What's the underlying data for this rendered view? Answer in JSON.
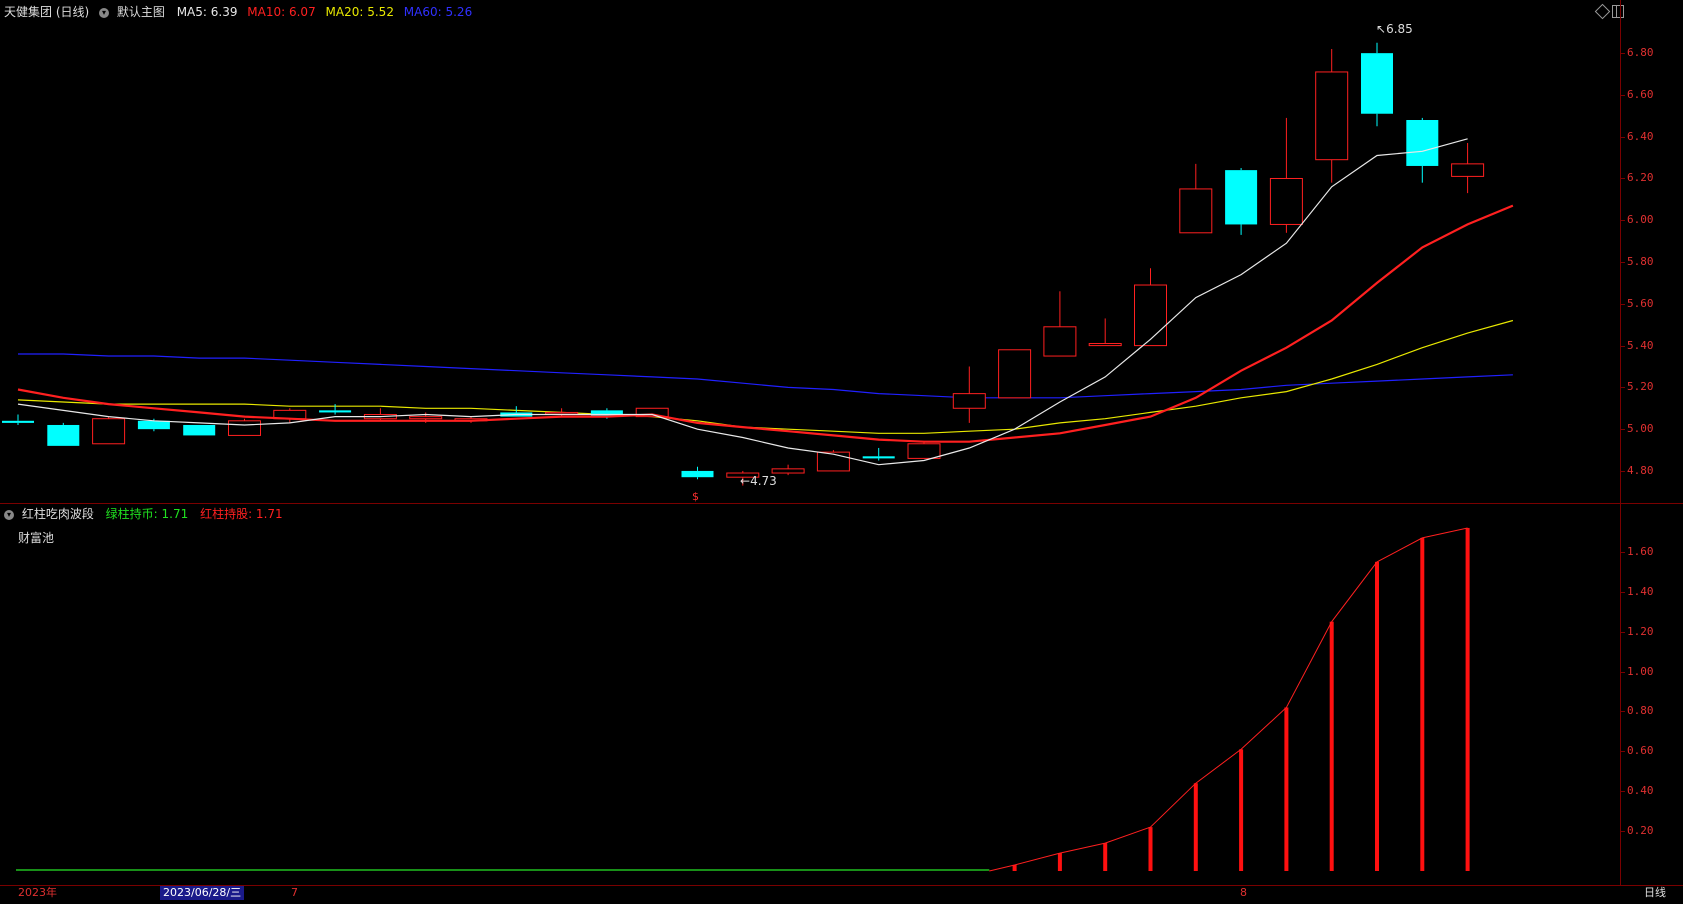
{
  "header": {
    "stock": "天健集团 (日线)",
    "main_chart": "默认主图",
    "ma5": "MA5: 6.39",
    "ma10": "MA10: 6.07",
    "ma20": "MA20: 5.52",
    "ma60": "MA60: 5.26"
  },
  "indicator": {
    "name": "红柱吃肉波段",
    "green": "绿柱持币: 1.71",
    "red": "红柱持股: 1.71",
    "pool_label": "财富池"
  },
  "annotations": {
    "high": "6.85",
    "low": "4.73",
    "signal": "$"
  },
  "price_axis": [
    "6.80",
    "6.60",
    "6.40",
    "6.20",
    "6.00",
    "5.80",
    "5.60",
    "5.40",
    "5.20",
    "5.00",
    "4.80"
  ],
  "ind_axis": [
    "1.60",
    "1.40",
    "1.20",
    "1.00",
    "0.80",
    "0.60",
    "0.40",
    "0.20"
  ],
  "bottom": {
    "year": "2023年",
    "date": "2023/06/28/三",
    "m7": "7",
    "m8": "8",
    "period": "日线"
  },
  "colors": {
    "up": "#ff2020",
    "down": "#00ffff",
    "ma5": "#e8e8e8",
    "ma10": "#ff2020",
    "ma20": "#e8e800",
    "ma60": "#2020ff"
  },
  "chart_data": {
    "type": "candlestick",
    "price_range": [
      4.7,
      6.85
    ],
    "candles": [
      {
        "o": 5.04,
        "h": 5.07,
        "l": 5.02,
        "c": 5.03
      },
      {
        "o": 5.02,
        "h": 5.03,
        "l": 4.92,
        "c": 4.92
      },
      {
        "o": 4.93,
        "h": 5.06,
        "l": 4.93,
        "c": 5.05
      },
      {
        "o": 5.04,
        "h": 5.05,
        "l": 4.99,
        "c": 5.0
      },
      {
        "o": 5.02,
        "h": 5.02,
        "l": 4.97,
        "c": 4.97
      },
      {
        "o": 4.97,
        "h": 5.05,
        "l": 4.97,
        "c": 5.04
      },
      {
        "o": 5.05,
        "h": 5.1,
        "l": 5.03,
        "c": 5.09
      },
      {
        "o": 5.09,
        "h": 5.12,
        "l": 5.07,
        "c": 5.08
      },
      {
        "o": 5.05,
        "h": 5.1,
        "l": 5.04,
        "c": 5.07
      },
      {
        "o": 5.05,
        "h": 5.08,
        "l": 5.03,
        "c": 5.06
      },
      {
        "o": 5.04,
        "h": 5.06,
        "l": 5.03,
        "c": 5.05
      },
      {
        "o": 5.08,
        "h": 5.11,
        "l": 5.06,
        "c": 5.06
      },
      {
        "o": 5.08,
        "h": 5.1,
        "l": 5.06,
        "c": 5.08
      },
      {
        "o": 5.09,
        "h": 5.1,
        "l": 5.05,
        "c": 5.06
      },
      {
        "o": 5.06,
        "h": 5.1,
        "l": 5.06,
        "c": 5.1
      },
      {
        "o": 4.8,
        "h": 4.82,
        "l": 4.76,
        "c": 4.77
      },
      {
        "o": 4.77,
        "h": 4.8,
        "l": 4.73,
        "c": 4.79
      },
      {
        "o": 4.79,
        "h": 4.83,
        "l": 4.78,
        "c": 4.81
      },
      {
        "o": 4.8,
        "h": 4.9,
        "l": 4.8,
        "c": 4.89
      },
      {
        "o": 4.87,
        "h": 4.91,
        "l": 4.85,
        "c": 4.86
      },
      {
        "o": 4.86,
        "h": 4.94,
        "l": 4.86,
        "c": 4.93
      },
      {
        "o": 5.1,
        "h": 5.3,
        "l": 5.03,
        "c": 5.17
      },
      {
        "o": 5.15,
        "h": 5.38,
        "l": 5.15,
        "c": 5.38
      },
      {
        "o": 5.35,
        "h": 5.66,
        "l": 5.35,
        "c": 5.49
      },
      {
        "o": 5.4,
        "h": 5.53,
        "l": 5.4,
        "c": 5.41
      },
      {
        "o": 5.4,
        "h": 5.77,
        "l": 5.4,
        "c": 5.69
      },
      {
        "o": 5.94,
        "h": 6.27,
        "l": 5.94,
        "c": 6.15
      },
      {
        "o": 6.24,
        "h": 6.25,
        "l": 5.93,
        "c": 5.98
      },
      {
        "o": 5.98,
        "h": 6.49,
        "l": 5.94,
        "c": 6.2
      },
      {
        "o": 6.29,
        "h": 6.82,
        "l": 6.18,
        "c": 6.71
      },
      {
        "o": 6.8,
        "h": 6.85,
        "l": 6.45,
        "c": 6.51
      },
      {
        "o": 6.48,
        "h": 6.49,
        "l": 6.18,
        "c": 6.26
      },
      {
        "o": 6.21,
        "h": 6.37,
        "l": 6.13,
        "c": 6.27
      }
    ],
    "ma5": [
      5.12,
      5.09,
      5.06,
      5.04,
      5.03,
      5.02,
      5.03,
      5.06,
      5.06,
      5.07,
      5.06,
      5.07,
      5.07,
      5.07,
      5.07,
      5.0,
      4.96,
      4.91,
      4.88,
      4.83,
      4.85,
      4.91,
      5.0,
      5.13,
      5.25,
      5.43,
      5.63,
      5.74,
      5.89,
      6.16,
      6.31,
      6.33,
      6.39
    ],
    "ma10": [
      5.19,
      5.15,
      5.12,
      5.1,
      5.08,
      5.06,
      5.05,
      5.04,
      5.04,
      5.04,
      5.04,
      5.05,
      5.06,
      5.06,
      5.07,
      5.03,
      5.01,
      4.99,
      4.97,
      4.95,
      4.94,
      4.94,
      4.96,
      4.98,
      5.02,
      5.06,
      5.15,
      5.28,
      5.39,
      5.52,
      5.7,
      5.87,
      5.98,
      6.07
    ],
    "ma20": [
      5.14,
      5.13,
      5.12,
      5.12,
      5.12,
      5.12,
      5.11,
      5.11,
      5.11,
      5.1,
      5.1,
      5.09,
      5.08,
      5.07,
      5.06,
      5.04,
      5.01,
      5.0,
      4.99,
      4.98,
      4.98,
      4.99,
      5.0,
      5.03,
      5.05,
      5.08,
      5.11,
      5.15,
      5.18,
      5.24,
      5.31,
      5.39,
      5.46,
      5.52
    ],
    "ma60": [
      5.36,
      5.36,
      5.35,
      5.35,
      5.34,
      5.34,
      5.33,
      5.32,
      5.31,
      5.3,
      5.29,
      5.28,
      5.27,
      5.26,
      5.25,
      5.24,
      5.22,
      5.2,
      5.19,
      5.17,
      5.16,
      5.15,
      5.15,
      5.15,
      5.16,
      5.17,
      5.18,
      5.19,
      5.21,
      5.22,
      5.23,
      5.24,
      5.25,
      5.26
    ],
    "pool": [
      0,
      0,
      0,
      0,
      0,
      0,
      0,
      0,
      0,
      0,
      0,
      0,
      0,
      0,
      0,
      0,
      0,
      0,
      0,
      0,
      0,
      0,
      0.03,
      0.09,
      0.14,
      0.22,
      0.44,
      0.61,
      0.82,
      1.25,
      1.55,
      1.67,
      1.72
    ],
    "pool_range": [
      0,
      1.8
    ]
  }
}
